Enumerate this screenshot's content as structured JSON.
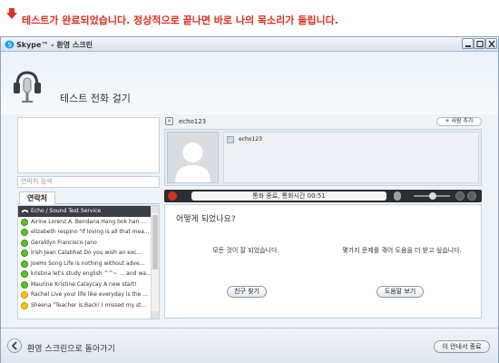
{
  "caption": {
    "text": "테스트가 완료되었습니다. 정상적으로 끝나면 바로 나의 목소리가 들립니다.",
    "color": "#e0301e"
  },
  "window": {
    "title": "Skype™ - 환영 스크린",
    "icons": [
      "skype-logo",
      "minimize",
      "maximize",
      "close"
    ]
  },
  "header": {
    "title": "테스트 전화 걸기",
    "icon": "headset-icon"
  },
  "left": {
    "search_placeholder": "연락처 검색",
    "tab_label": "연락처",
    "contacts": [
      {
        "status": "phone",
        "text": "Echo / Sound Test Service",
        "selected": true
      },
      {
        "status": "online",
        "text": "Airine Lorenz A. Bendana  Hang bok han ..."
      },
      {
        "status": "online",
        "text": "elizabeth respino  \"if loving is all that mea..."
      },
      {
        "status": "online",
        "text": "Geraldyn Francisco-Jano"
      },
      {
        "status": "online",
        "text": "Irish Jean Calabhat  Do you wish an exc..."
      },
      {
        "status": "online",
        "text": "JoeHo Song  Life is nothing without adve..."
      },
      {
        "status": "online",
        "text": "kristina  let's study english ^^~ ... and wa..."
      },
      {
        "status": "online",
        "text": "Maurine Kristine Calaycay  A new start!"
      },
      {
        "status": "away",
        "text": "Rachel  Live your life like everyday is the ..."
      },
      {
        "status": "away",
        "text": "Sheena  \"Teacher is Back! I missed my st..."
      }
    ]
  },
  "call": {
    "contact_name": "echo123",
    "add_person_label": "+ 사람 추가",
    "participant_name": "echo123",
    "status_text": "통화 종료, 통화시간 00:51"
  },
  "message": {
    "question": "어떻게 되었나요?",
    "left_text": "모든 것이 잘 되었습니다.",
    "right_text": "몇가지 문제를 겪어 도움을 더 받고 싶습니다.",
    "find_friends_label": "친구 찾기",
    "help_more_label": "도움말 보기"
  },
  "bottom": {
    "back_label": "환영 스크린으로 돌아가기",
    "dont_show_label": "이 안내서 종료"
  },
  "colors": {
    "online": "#5fbf2f",
    "away": "#f4c40f",
    "hangup": "#d6321f",
    "call_bar": "#2a2d31"
  }
}
